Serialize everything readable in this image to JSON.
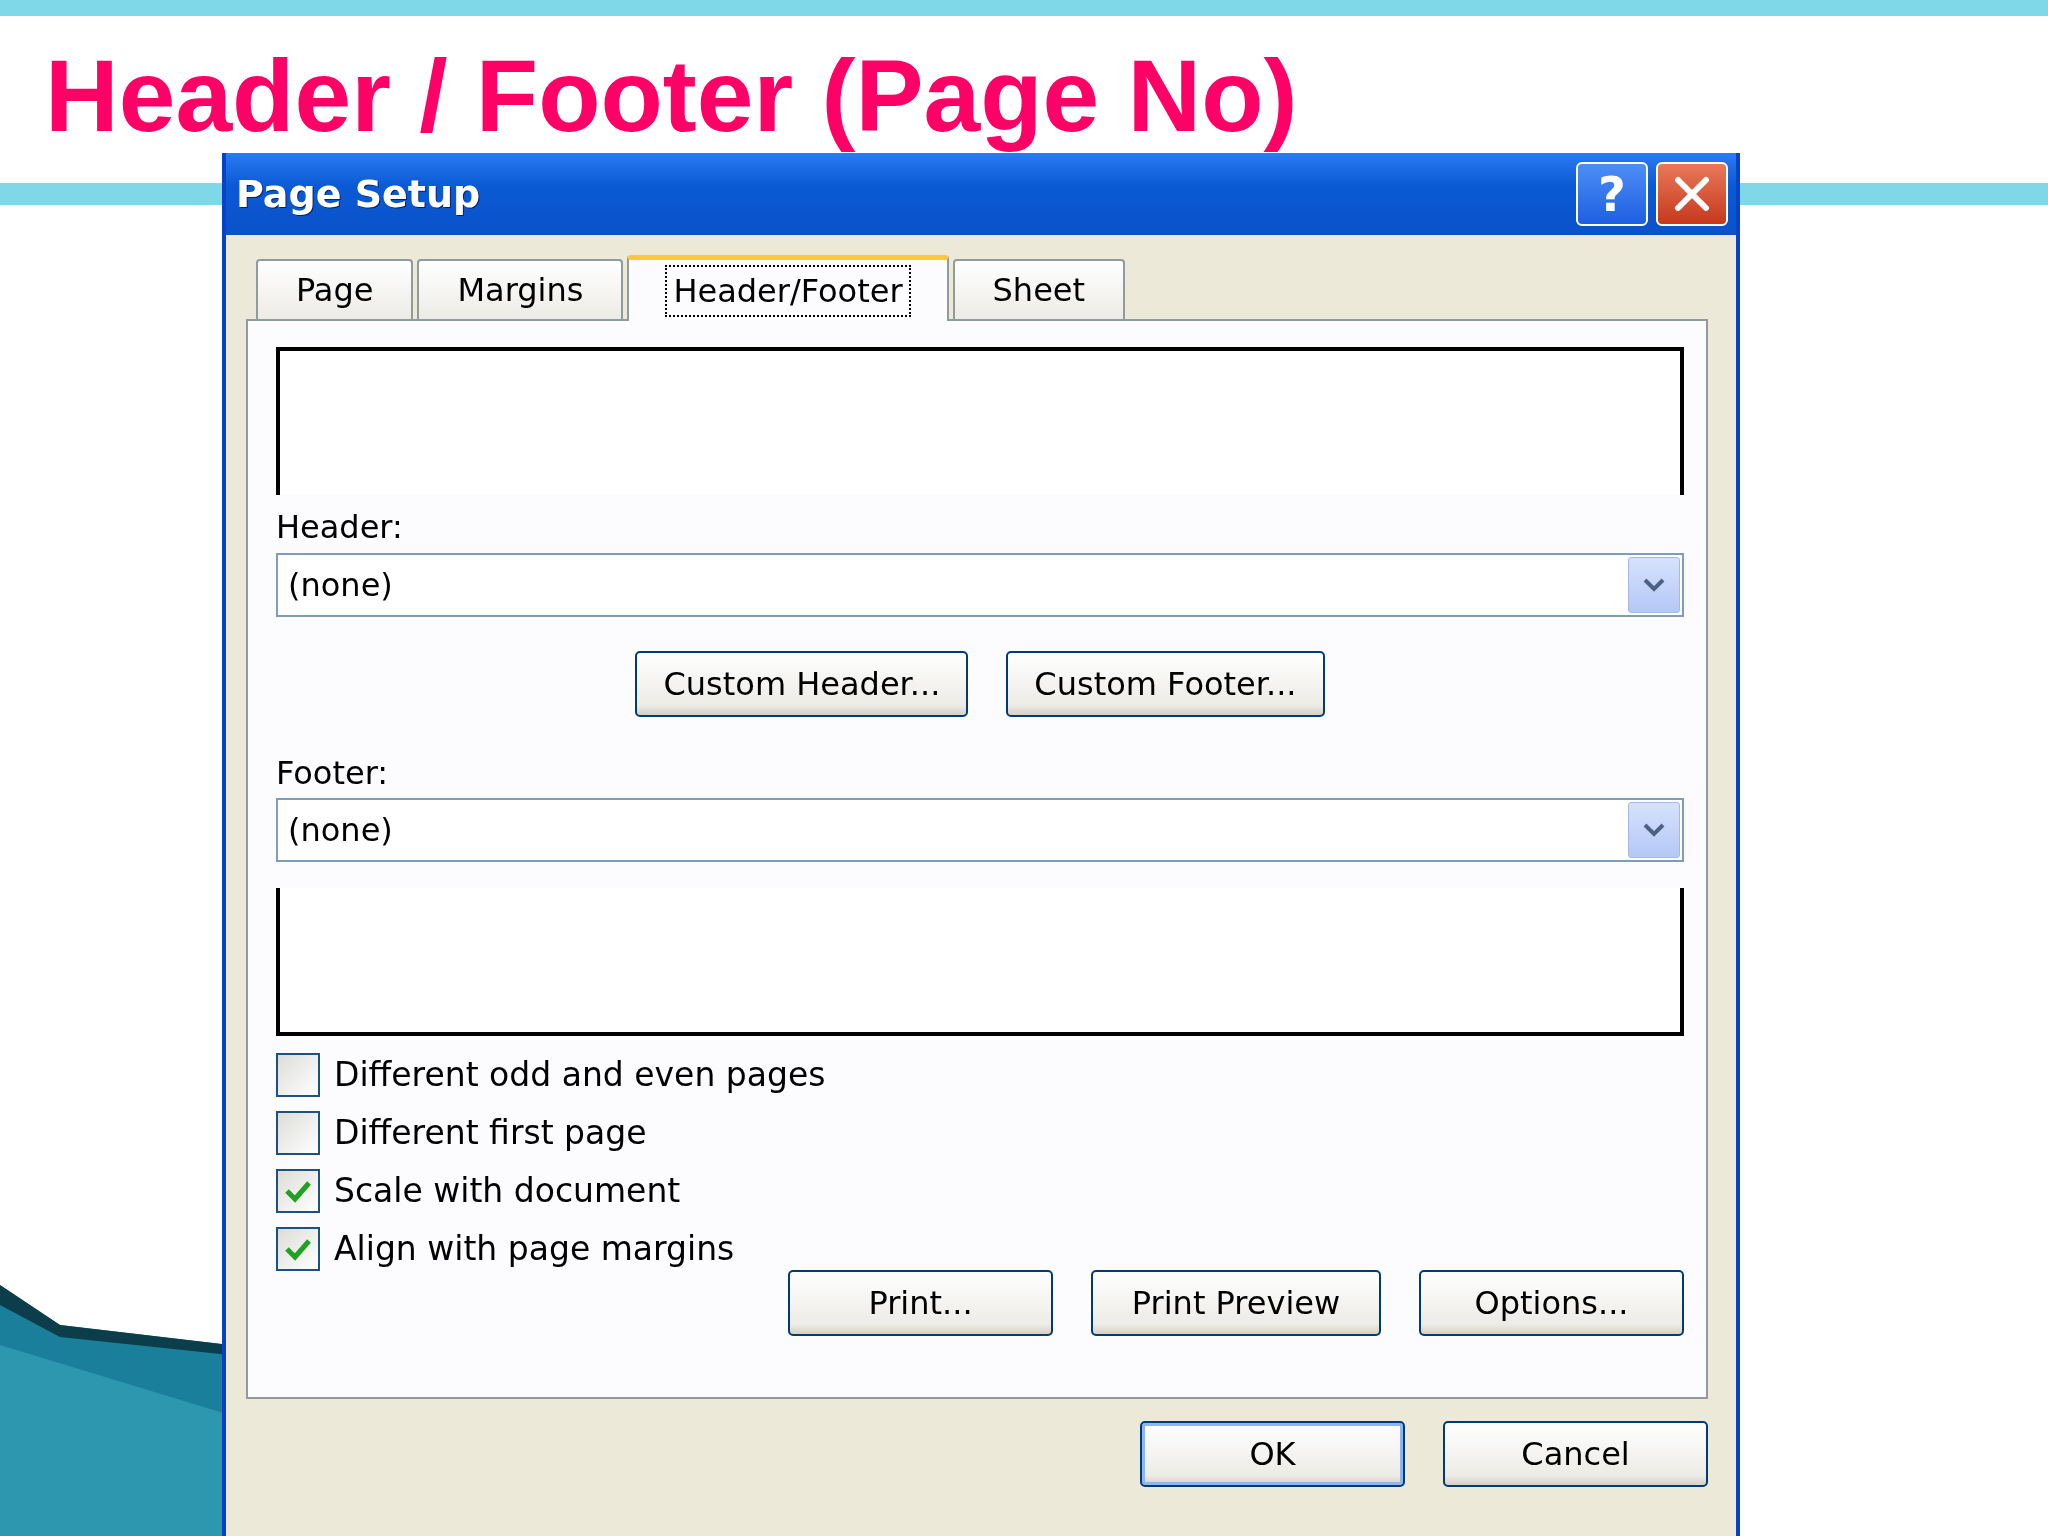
{
  "slide": {
    "title": "Header / Footer (Page No)"
  },
  "window": {
    "title": "Page Setup",
    "help": "?"
  },
  "tabs": [
    {
      "label": "Page",
      "selected": false
    },
    {
      "label": "Margins",
      "selected": false
    },
    {
      "label": "Header/Footer",
      "selected": true
    },
    {
      "label": "Sheet",
      "selected": false
    }
  ],
  "header": {
    "label": "Header:",
    "value": "(none)"
  },
  "custom_buttons": [
    "Custom Header...",
    "Custom Footer..."
  ],
  "footer": {
    "label": "Footer:",
    "value": "(none)"
  },
  "checkboxes": [
    {
      "label": "Different odd and even pages",
      "checked": false
    },
    {
      "label": "Different first page",
      "checked": false
    },
    {
      "label": "Scale with document",
      "checked": true
    },
    {
      "label": "Align with page margins",
      "checked": true
    }
  ],
  "action_buttons": [
    "Print...",
    "Print Preview",
    "Options..."
  ],
  "dialog_buttons": [
    {
      "label": "OK",
      "default": true
    },
    {
      "label": "Cancel",
      "default": false
    }
  ]
}
